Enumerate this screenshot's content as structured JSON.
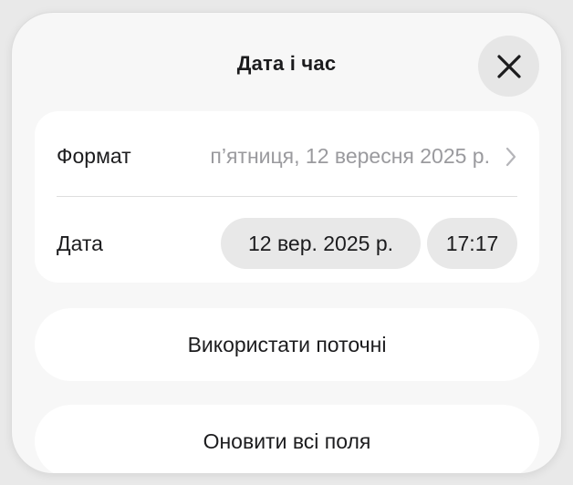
{
  "dialog": {
    "title": "Дата і час",
    "close_icon": "close-icon"
  },
  "settings": {
    "format_label": "Формат",
    "format_value": "п’ятниця, 12 вересня 2025 р.",
    "date_label": "Дата",
    "date_value": "12 вер. 2025 р.",
    "time_value": "17:17"
  },
  "actions": {
    "use_current": "Використати поточні",
    "update_all": "Оновити всі поля"
  }
}
